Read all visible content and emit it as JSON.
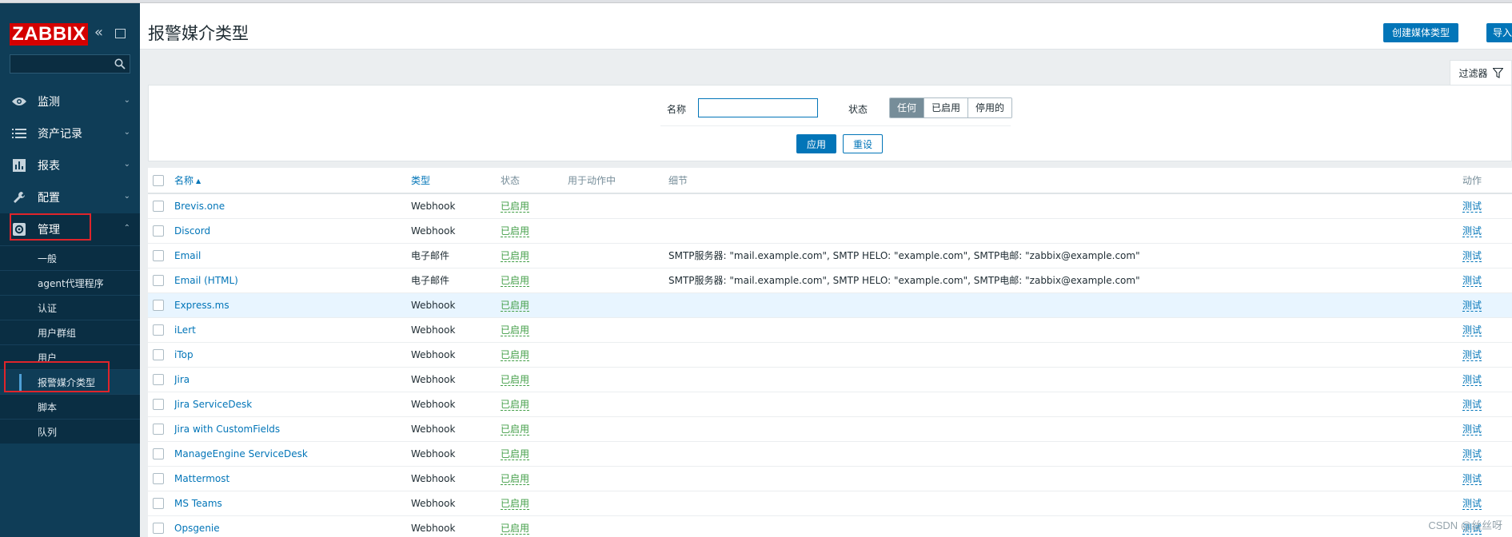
{
  "app": {
    "logo_text": "ZABBIX",
    "brand_color": "#d40000",
    "sidebar_color": "#0f3d57",
    "accent_color": "#0275b8"
  },
  "sidebar": {
    "search_placeholder": "",
    "menu": [
      {
        "label": "监测",
        "icon": "eye-icon",
        "expanded": false
      },
      {
        "label": "资产记录",
        "icon": "list-icon",
        "expanded": false
      },
      {
        "label": "报表",
        "icon": "bar-chart-icon",
        "expanded": false
      },
      {
        "label": "配置",
        "icon": "wrench-icon",
        "expanded": false
      },
      {
        "label": "管理",
        "icon": "gear-icon",
        "expanded": true
      }
    ],
    "admin_submenu": [
      {
        "label": "一般"
      },
      {
        "label": "agent代理程序"
      },
      {
        "label": "认证"
      },
      {
        "label": "用户群组"
      },
      {
        "label": "用户"
      },
      {
        "label": "报警媒介类型",
        "selected": true
      },
      {
        "label": "脚本"
      },
      {
        "label": "队列"
      }
    ]
  },
  "header": {
    "title": "报警媒介类型",
    "create_button": "创建媒体类型",
    "import_button": "导入"
  },
  "filter": {
    "tab_label": "过滤器",
    "name_label": "名称",
    "name_value": "",
    "status_label": "状态",
    "status_options": [
      "任何",
      "已启用",
      "停用的"
    ],
    "status_selected": "任何",
    "apply_button": "应用",
    "reset_button": "重设"
  },
  "table": {
    "headers": {
      "name": "名称",
      "type": "类型",
      "status": "状态",
      "used_in_actions": "用于动作中",
      "details": "细节",
      "action": "动作"
    },
    "sort_column": "名称",
    "sort_direction": "asc",
    "rows": [
      {
        "name": "Brevis.one",
        "type": "Webhook",
        "status": "已启用",
        "used": "",
        "details": "",
        "action": "测试"
      },
      {
        "name": "Discord",
        "type": "Webhook",
        "status": "已启用",
        "used": "",
        "details": "",
        "action": "测试"
      },
      {
        "name": "Email",
        "type": "电子邮件",
        "status": "已启用",
        "used": "",
        "details": "SMTP服务器: \"mail.example.com\", SMTP HELO: \"example.com\", SMTP电邮: \"zabbix@example.com\"",
        "action": "测试"
      },
      {
        "name": "Email (HTML)",
        "type": "电子邮件",
        "status": "已启用",
        "used": "",
        "details": "SMTP服务器: \"mail.example.com\", SMTP HELO: \"example.com\", SMTP电邮: \"zabbix@example.com\"",
        "action": "测试"
      },
      {
        "name": "Express.ms",
        "type": "Webhook",
        "status": "已启用",
        "used": "",
        "details": "",
        "action": "测试"
      },
      {
        "name": "iLert",
        "type": "Webhook",
        "status": "已启用",
        "used": "",
        "details": "",
        "action": "测试"
      },
      {
        "name": "iTop",
        "type": "Webhook",
        "status": "已启用",
        "used": "",
        "details": "",
        "action": "测试"
      },
      {
        "name": "Jira",
        "type": "Webhook",
        "status": "已启用",
        "used": "",
        "details": "",
        "action": "测试"
      },
      {
        "name": "Jira ServiceDesk",
        "type": "Webhook",
        "status": "已启用",
        "used": "",
        "details": "",
        "action": "测试"
      },
      {
        "name": "Jira with CustomFields",
        "type": "Webhook",
        "status": "已启用",
        "used": "",
        "details": "",
        "action": "测试"
      },
      {
        "name": "ManageEngine ServiceDesk",
        "type": "Webhook",
        "status": "已启用",
        "used": "",
        "details": "",
        "action": "测试"
      },
      {
        "name": "Mattermost",
        "type": "Webhook",
        "status": "已启用",
        "used": "",
        "details": "",
        "action": "测试"
      },
      {
        "name": "MS Teams",
        "type": "Webhook",
        "status": "已启用",
        "used": "",
        "details": "",
        "action": "测试"
      },
      {
        "name": "Opsgenie",
        "type": "Webhook",
        "status": "已启用",
        "used": "",
        "details": "",
        "action": "测试"
      }
    ]
  },
  "watermark": "CSDN @丝丝呀"
}
